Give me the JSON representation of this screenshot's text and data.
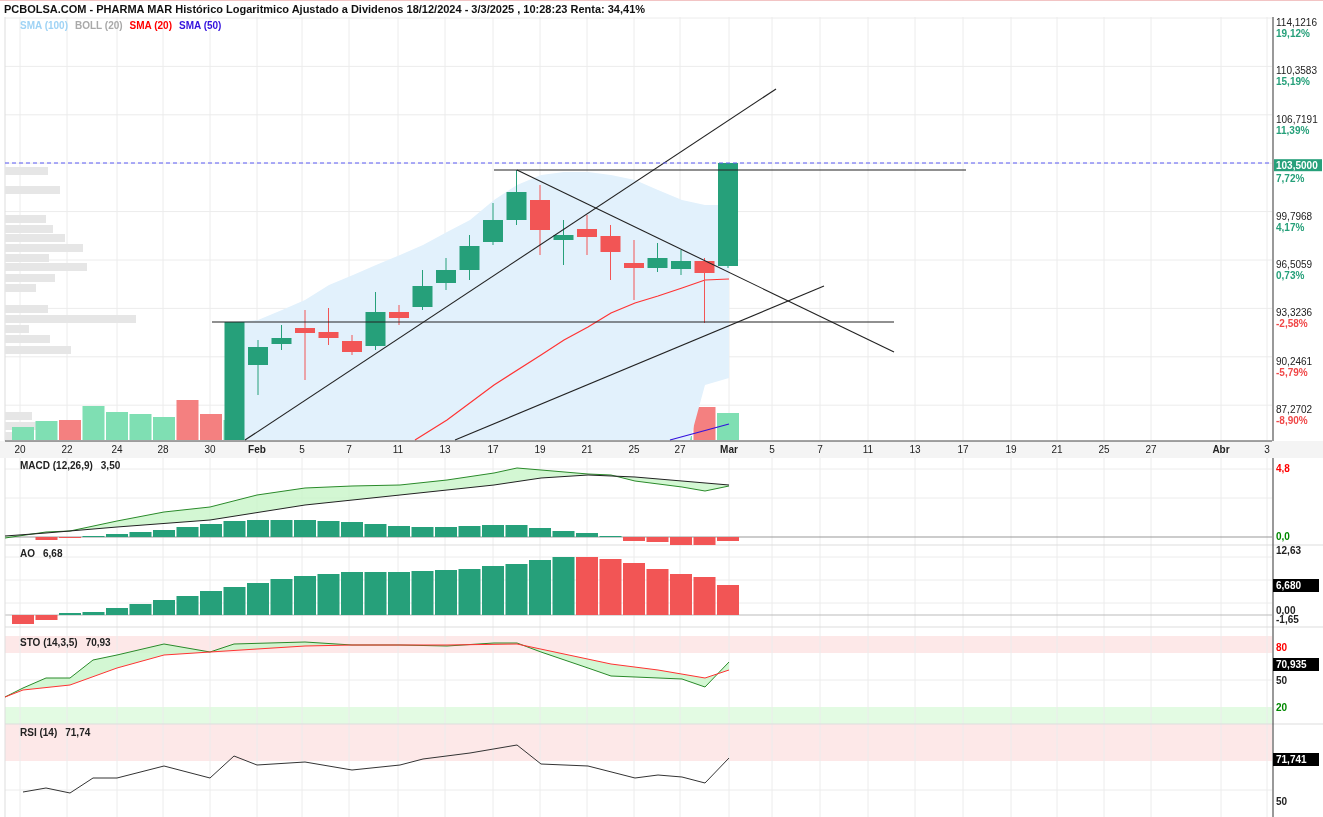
{
  "title": "PCBOLSA.COM - PHARMA MAR Histórico Logaritmico Ajustado a Dividenos 18/12/2024 - 3/3/2025 , 10:28:23 Renta: 34,41%",
  "legend": [
    {
      "label": "SMA (100)",
      "color": "#9fd3f5"
    },
    {
      "label": "BOLL (20)",
      "color": "#a9a9a9"
    },
    {
      "label": "SMA (20)",
      "color": "#ff0000"
    },
    {
      "label": "SMA (50)",
      "color": "#3311dd"
    }
  ],
  "price_axis": [
    {
      "kind": "tick",
      "price": "114,1216",
      "change": "19,12%",
      "color": "#26a07a"
    },
    {
      "kind": "tick",
      "price": "110,3583",
      "change": "15,19%",
      "color": "#26a07a"
    },
    {
      "kind": "tick",
      "price": "106,7191",
      "change": "11,39%",
      "color": "#26a07a"
    },
    {
      "kind": "last",
      "price": "103,5000",
      "change": "7,72%",
      "color": "#26a07a"
    },
    {
      "kind": "tick",
      "price": "99,7968",
      "change": "4,17%",
      "color": "#26a07a"
    },
    {
      "kind": "tick",
      "price": "96,5059",
      "change": "0,73%",
      "color": "#26a07a"
    },
    {
      "kind": "tick",
      "price": "93,3236",
      "change": "-2,58%",
      "color": "#f04848"
    },
    {
      "kind": "tick",
      "price": "90,2461",
      "change": "-5,79%",
      "color": "#f04848"
    },
    {
      "kind": "tick",
      "price": "87,2702",
      "change": "-8,90%",
      "color": "#f04848"
    }
  ],
  "date_axis": [
    {
      "label": "20",
      "kind": "day"
    },
    {
      "label": "22",
      "kind": "day"
    },
    {
      "label": "24",
      "kind": "day"
    },
    {
      "label": "28",
      "kind": "day"
    },
    {
      "label": "30",
      "kind": "day"
    },
    {
      "label": "Feb",
      "kind": "month"
    },
    {
      "label": "5",
      "kind": "day"
    },
    {
      "label": "7",
      "kind": "day"
    },
    {
      "label": "11",
      "kind": "day"
    },
    {
      "label": "13",
      "kind": "day"
    },
    {
      "label": "17",
      "kind": "day"
    },
    {
      "label": "19",
      "kind": "day"
    },
    {
      "label": "21",
      "kind": "day"
    },
    {
      "label": "25",
      "kind": "day"
    },
    {
      "label": "27",
      "kind": "day"
    },
    {
      "label": "Mar",
      "kind": "month"
    },
    {
      "label": "5",
      "kind": "day"
    },
    {
      "label": "7",
      "kind": "day"
    },
    {
      "label": "11",
      "kind": "day"
    },
    {
      "label": "13",
      "kind": "day"
    },
    {
      "label": "17",
      "kind": "day"
    },
    {
      "label": "19",
      "kind": "day"
    },
    {
      "label": "21",
      "kind": "day"
    },
    {
      "label": "25",
      "kind": "day"
    },
    {
      "label": "27",
      "kind": "day"
    },
    {
      "label": "Abr",
      "kind": "month"
    },
    {
      "label": "3",
      "kind": "day"
    }
  ],
  "panels": [
    {
      "kind": "macd",
      "label": "MACD (12,26,9)",
      "reading": "3,50",
      "axis": [
        {
          "text": "4,8",
          "color": "#ff0000"
        },
        {
          "text": "0,0",
          "color": "#008800"
        }
      ]
    },
    {
      "kind": "ao",
      "label": "AO",
      "reading": "6,68",
      "value_tag": "6,680",
      "axis": [
        {
          "text": "12,63",
          "color": "#222222"
        },
        {
          "text": "0,00",
          "color": "#222222"
        },
        {
          "text": "-1,65",
          "color": "#222222"
        }
      ]
    },
    {
      "kind": "sto",
      "label": "STO (14,3,5)",
      "reading": "70,93",
      "value_tag": "70,935",
      "axis": [
        {
          "text": "80",
          "color": "#ff0000"
        },
        {
          "text": "50",
          "color": "#222222"
        },
        {
          "text": "20",
          "color": "#008800"
        }
      ]
    },
    {
      "kind": "rsi",
      "label": "RSI (14)",
      "reading": "71,74",
      "value_tag": "71,741",
      "axis": [
        {
          "text": "50",
          "color": "#222222"
        }
      ]
    }
  ]
}
